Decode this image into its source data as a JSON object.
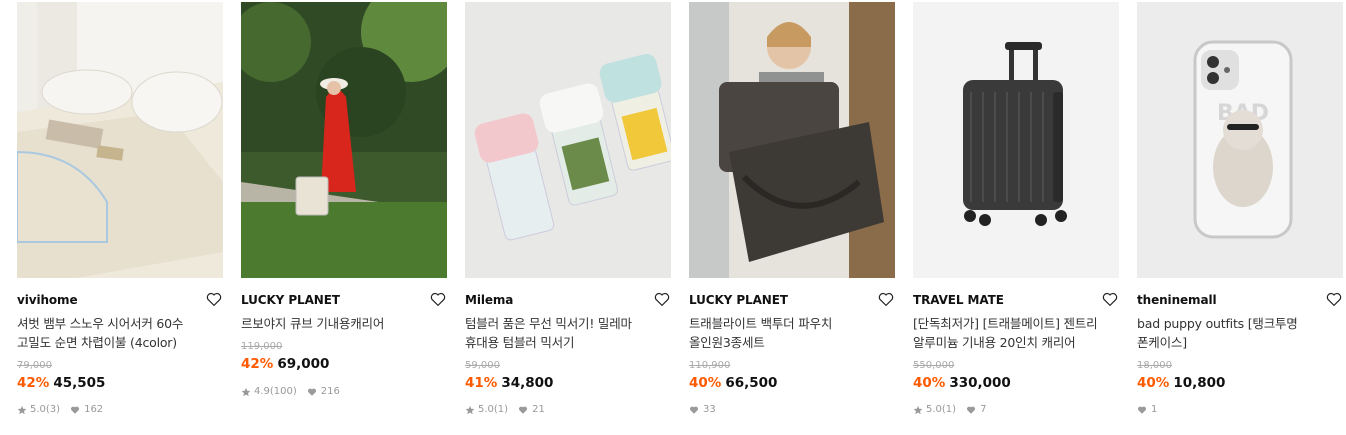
{
  "products": [
    {
      "brand": "vivihome",
      "title_line1": "셔벗 뱀부 스노우 시어서커 60수",
      "title_line2": "고밀도 순면 차렵이불 (4color)",
      "original_price": "79,000",
      "discount": "42%",
      "price": "45,505",
      "rating": "5.0",
      "reviews": "(3)",
      "likes": "162"
    },
    {
      "brand": "LUCKY PLANET",
      "title_line1": "르보야지 큐브 기내용캐리어",
      "title_line2": "",
      "original_price": "119,000",
      "discount": "42%",
      "price": "69,000",
      "rating": "4.9",
      "reviews": "(100)",
      "likes": "216"
    },
    {
      "brand": "Milema",
      "title_line1": "텀블러 품은 무선 믹서기! 밀레마",
      "title_line2": "휴대용 텀블러 믹서기",
      "original_price": "59,000",
      "discount": "41%",
      "price": "34,800",
      "rating": "5.0",
      "reviews": "(1)",
      "likes": "21"
    },
    {
      "brand": "LUCKY PLANET",
      "title_line1": "트래블라이트 백투더 파우치",
      "title_line2": "올인원3종세트",
      "original_price": "110,900",
      "discount": "40%",
      "price": "66,500",
      "rating": "",
      "reviews": "",
      "likes": "33"
    },
    {
      "brand": "TRAVEL MATE",
      "title_line1": "[단독최저가] [트래블메이트] 젠트리",
      "title_line2": "알루미늄 기내용 20인치 캐리어",
      "original_price": "550,000",
      "discount": "40%",
      "price": "330,000",
      "rating": "5.0",
      "reviews": "(1)",
      "likes": "7"
    },
    {
      "brand": "theninemall",
      "title_line1": "bad puppy outfits [탱크투명",
      "title_line2": "폰케이스]",
      "original_price": "18,000",
      "discount": "40%",
      "price": "10,800",
      "rating": "",
      "reviews": "",
      "likes": "1"
    }
  ],
  "colors": {
    "discount": "#ff5a00",
    "icon_gray": "#9a9a9a"
  },
  "icons": {
    "wishlist": "heart-outline-icon",
    "rating": "star-icon",
    "likes": "heart-filled-icon"
  },
  "image_text": {
    "phone_case_graphic": "BAD"
  }
}
